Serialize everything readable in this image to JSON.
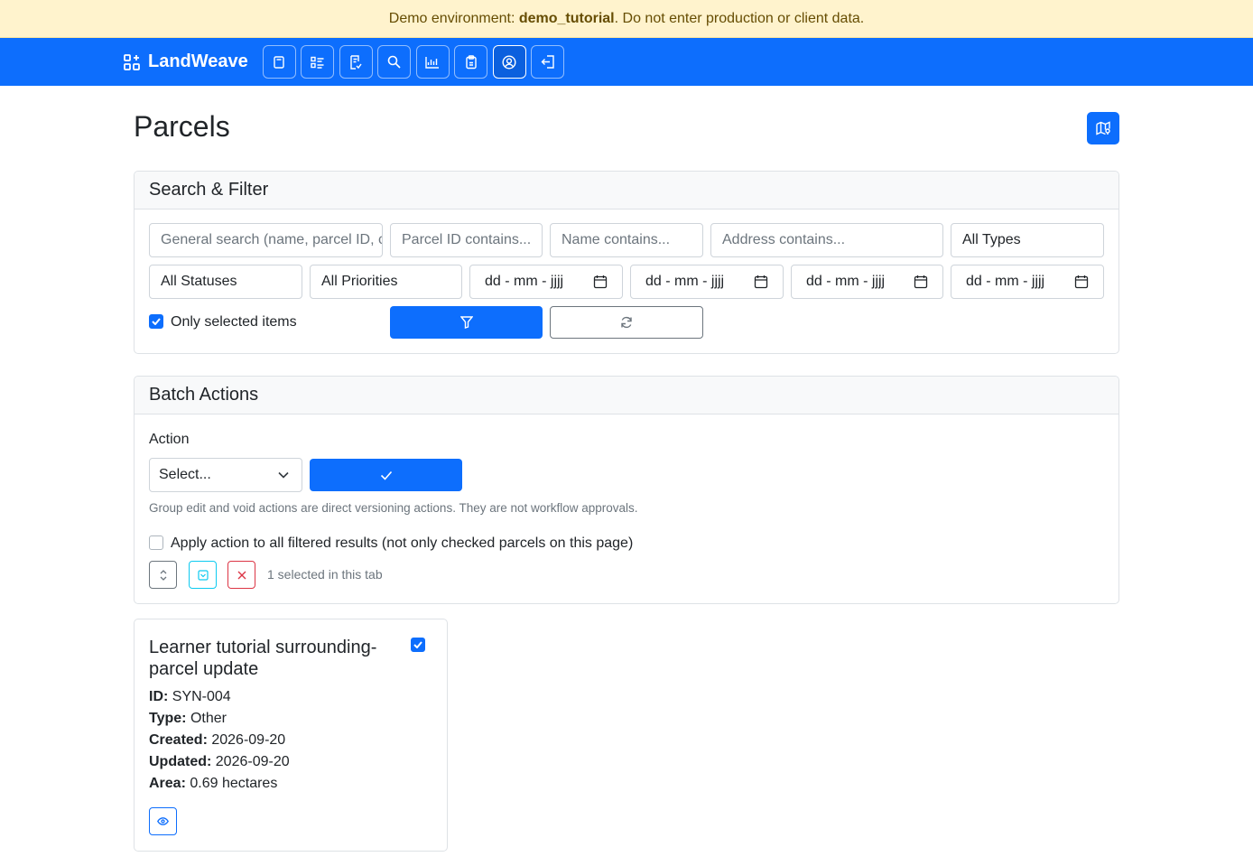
{
  "banner": {
    "prefix": "Demo environment: ",
    "env": "demo_tutorial",
    "suffix": ". Do not enter production or client data."
  },
  "nav": {
    "brand": "LandWeave"
  },
  "page": {
    "title": "Parcels"
  },
  "filter": {
    "header": "Search & Filter",
    "general_placeholder": "General search (name, parcel ID, c",
    "parcel_id_placeholder": "Parcel ID contains...",
    "name_placeholder": "Name contains...",
    "address_placeholder": "Address contains...",
    "type_value": "All Types",
    "status_value": "All Statuses",
    "priority_value": "All Priorities",
    "date_placeholder": "dd - mm - jjjj",
    "only_selected_label": "Only selected items"
  },
  "batch": {
    "header": "Batch Actions",
    "action_label": "Action",
    "action_value": "Select...",
    "help_text": "Group edit and void actions are direct versioning actions. They are not workflow approvals.",
    "apply_all_label": "Apply action to all filtered results (not only checked parcels on this page)",
    "selected_count": "1 selected in this tab"
  },
  "parcel": {
    "title": "Learner tutorial surrounding-parcel update",
    "id_label": "ID:",
    "id_value": "SYN-004",
    "type_label": "Type:",
    "type_value": "Other",
    "created_label": "Created:",
    "created_value": "2026-09-20",
    "updated_label": "Updated:",
    "updated_value": "2026-09-20",
    "area_label": "Area:",
    "area_value": "0.69 hectares"
  },
  "colors": {
    "primary": "#0d6efd",
    "banner_bg": "#fff3cd",
    "info": "#0dcaf0",
    "danger": "#dc3545"
  }
}
